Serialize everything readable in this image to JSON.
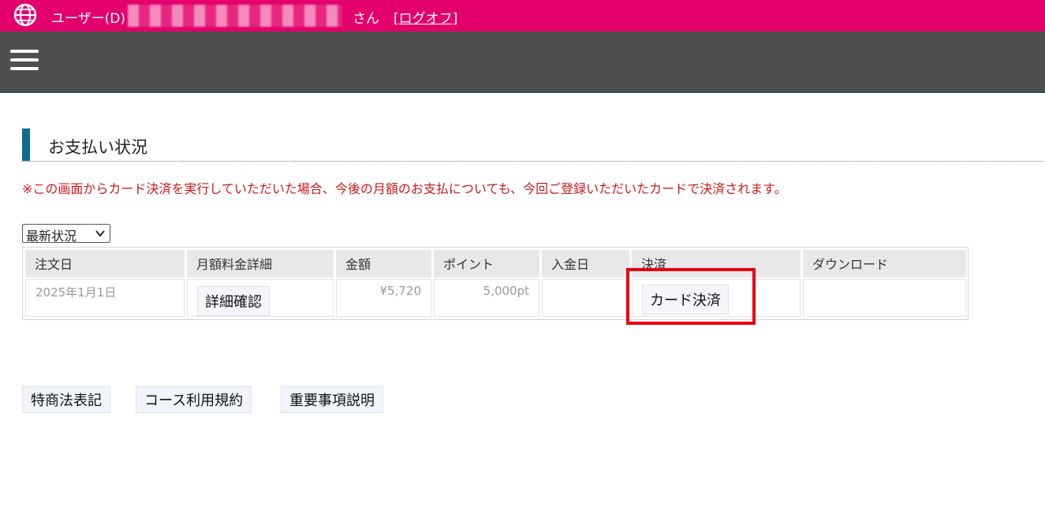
{
  "header": {
    "user_prefix": "ユーザー(D)",
    "user_suffix": "さん",
    "logout_open": "[",
    "logout_label": "ログオフ",
    "logout_close": "]"
  },
  "section": {
    "title": "お支払い状況"
  },
  "notice": "※この画面からカード決済を実行していただいた場合、今後の月額のお支払についても、今回ご登録いただいたカードで決済されます。",
  "filter": {
    "selected": "最新状況"
  },
  "table": {
    "headers": [
      "注文日",
      "月額料金詳細",
      "金額",
      "ポイント",
      "入金日",
      "決済",
      "ダウンロード"
    ],
    "rows": [
      {
        "order_date": "2025年1月1日",
        "detail_button": "詳細確認",
        "amount": "¥5,720",
        "points": "5,000pt",
        "paid_date": "",
        "pay_button": "カード決済",
        "download": ""
      }
    ]
  },
  "footer": {
    "links": [
      "特商法表記",
      "コース利用規約",
      "重要事項説明"
    ]
  },
  "colors": {
    "topbar": "#e4006c",
    "navbar": "#4f4f4f",
    "accent": "#0d6e8e",
    "notice": "#cc1a1a",
    "highlight": "#e60012"
  }
}
